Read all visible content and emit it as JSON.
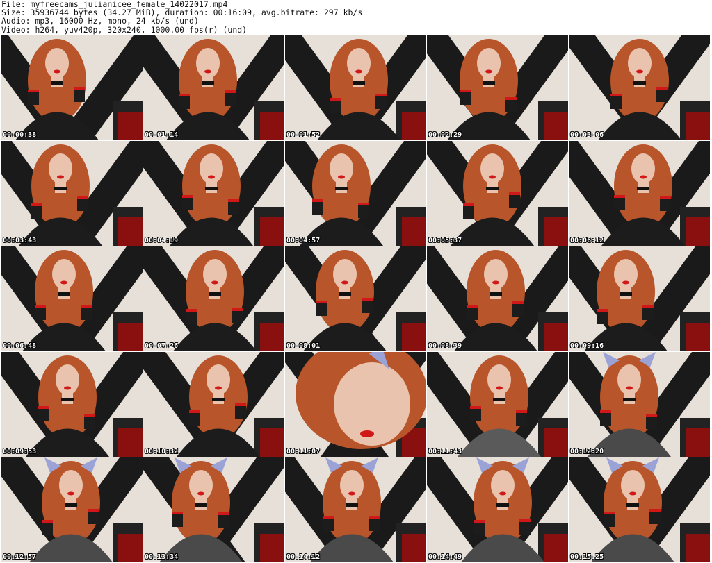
{
  "header": {
    "file": "File: myfreecams_julianicee_female_14022017.mp4",
    "size": "Size: 35936744 bytes (34.27 MiB), duration: 00:16:09, avg.bitrate: 297 kb/s",
    "audio": "Audio: mp3, 16000 Hz, mono, 24 kb/s (und)",
    "video": "Video: h264, yuv420p, 320x240, 1000.00 fps(r) (und)"
  },
  "thumbnails": [
    {
      "time": "00:00:38",
      "variant": "lace"
    },
    {
      "time": "00:01:14",
      "variant": "lace"
    },
    {
      "time": "00:01:52",
      "variant": "lace"
    },
    {
      "time": "00:02:29",
      "variant": "lace"
    },
    {
      "time": "00:03:06",
      "variant": "lace"
    },
    {
      "time": "00:03:43",
      "variant": "lace"
    },
    {
      "time": "00:04:19",
      "variant": "lace"
    },
    {
      "time": "00:04:57",
      "variant": "lace"
    },
    {
      "time": "00:05:37",
      "variant": "lace"
    },
    {
      "time": "00:06:12",
      "variant": "lace"
    },
    {
      "time": "00:06:48",
      "variant": "lace"
    },
    {
      "time": "00:07:26",
      "variant": "lace"
    },
    {
      "time": "00:08:01",
      "variant": "lace"
    },
    {
      "time": "00:08:39",
      "variant": "lace"
    },
    {
      "time": "00:09:16",
      "variant": "lace"
    },
    {
      "time": "00:09:53",
      "variant": "lace"
    },
    {
      "time": "00:10:32",
      "variant": "lace"
    },
    {
      "time": "00:11:07",
      "variant": "closeup"
    },
    {
      "time": "00:11:43",
      "variant": "shirt"
    },
    {
      "time": "00:12:20",
      "variant": "ears"
    },
    {
      "time": "00:12:57",
      "variant": "ears"
    },
    {
      "time": "00:13:34",
      "variant": "ears"
    },
    {
      "time": "00:14:12",
      "variant": "ears"
    },
    {
      "time": "00:14:49",
      "variant": "ears"
    },
    {
      "time": "00:15:25",
      "variant": "ears"
    }
  ],
  "colors": {
    "wall": "#e6e0d8",
    "stripe": "#1a1a1a",
    "hair": "#b8552a",
    "skin": "#e9c3ad",
    "lace": "#1c1c1c",
    "accent_red": "#d01818",
    "shirt": "#5a5a5a",
    "ears": "#9aa2d6"
  }
}
